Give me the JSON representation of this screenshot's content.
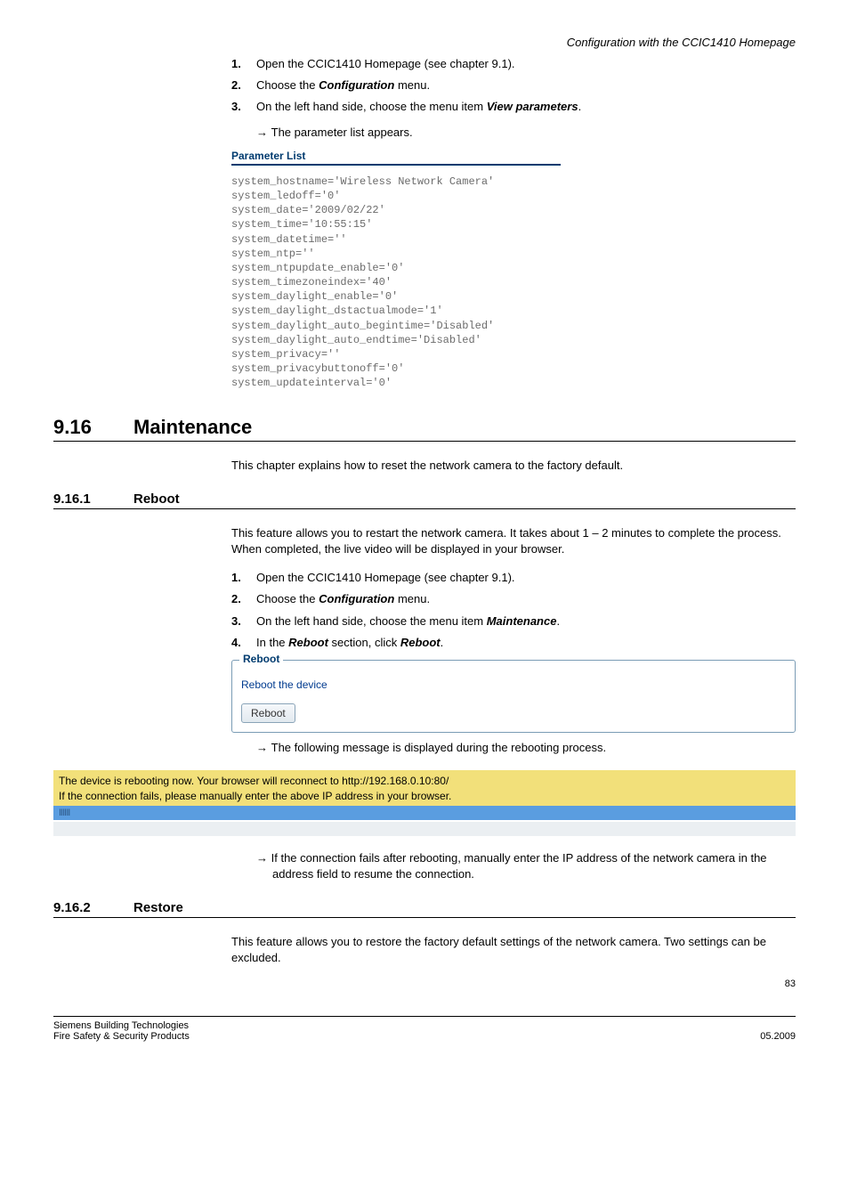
{
  "header": {
    "context": "Configuration with the CCIC1410 Homepage"
  },
  "top_steps": {
    "s1_num": "1.",
    "s1_text_a": "Open the CCIC1410 Homepage (see chapter ",
    "s1_text_b": "9.1",
    "s1_text_c": ").",
    "s2_num": "2.",
    "s2_text_a": "Choose the ",
    "s2_bold": "Configuration",
    "s2_text_b": " menu.",
    "s3_num": "3.",
    "s3_text_a": "On the left hand side, choose the menu item ",
    "s3_bold": "View parameters",
    "s3_text_b": ".",
    "s3_arrow": "The parameter list appears."
  },
  "param_list": {
    "title": "Parameter List",
    "body": "system_hostname='Wireless Network Camera'\nsystem_ledoff='0'\nsystem_date='2009/02/22'\nsystem_time='10:55:15'\nsystem_datetime=''\nsystem_ntp=''\nsystem_ntpupdate_enable='0'\nsystem_timezoneindex='40'\nsystem_daylight_enable='0'\nsystem_daylight_dstactualmode='1'\nsystem_daylight_auto_begintime='Disabled'\nsystem_daylight_auto_endtime='Disabled'\nsystem_privacy=''\nsystem_privacybuttonoff='0'\nsystem_updateinterval='0'"
  },
  "section_916": {
    "num": "9.16",
    "title": "Maintenance",
    "intro": "This chapter explains how to reset the network camera to the factory default."
  },
  "section_9161": {
    "num": "9.16.1",
    "title": "Reboot",
    "intro": "This feature allows you to restart the network camera. It takes about 1 – 2 minutes to complete the process. When completed, the live video will be displayed in your browser.",
    "s1_num": "1.",
    "s1_text_a": "Open the CCIC1410 Homepage (see chapter ",
    "s1_text_b": "9.1",
    "s1_text_c": ").",
    "s2_num": "2.",
    "s2_text_a": "Choose the ",
    "s2_bold": "Configuration",
    "s2_text_b": " menu.",
    "s3_num": "3.",
    "s3_text_a": "On the left hand side, choose the menu item ",
    "s3_bold": "Maintenance",
    "s3_text_b": ".",
    "s4_num": "4.",
    "s4_text_a": "In the ",
    "s4_bold1": "Reboot",
    "s4_text_b": " section, click ",
    "s4_bold2": "Reboot",
    "s4_text_c": ".",
    "legend": "Reboot",
    "field_desc": "Reboot the device",
    "button_label": "Reboot",
    "arrow1": "The following message is displayed during the rebooting process.",
    "banner_l1": "The device is rebooting now. Your browser will reconnect to http://192.168.0.10:80/",
    "banner_l2": "If the connection fails, please manually enter the above IP address in your browser.",
    "arrow2": "If the connection fails after rebooting, manually enter the IP address of the network camera in the address field to resume the connection."
  },
  "section_9162": {
    "num": "9.16.2",
    "title": "Restore",
    "intro": "This feature allows you to restore the factory default settings of the network camera. Two settings can be excluded."
  },
  "footer": {
    "page_num": "83",
    "left1": "Siemens Building Technologies",
    "left2": "Fire Safety & Security Products",
    "right": "05.2009"
  },
  "bars": "IIIIII"
}
